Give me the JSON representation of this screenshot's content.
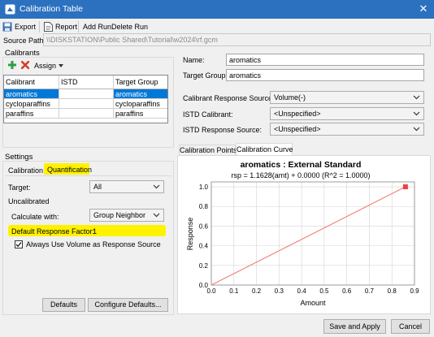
{
  "window": {
    "title": "Calibration Table",
    "close_glyph": "✕"
  },
  "toolbar": {
    "export_label": "Export",
    "report_label": "Report",
    "add_run_label": "Add Run",
    "delete_run_label": "Delete Run"
  },
  "source_path": {
    "label": "Source Path:",
    "value": "\\\\DISKSTATION\\Public Shared\\Tutorial\\w2024\\rf.gcm"
  },
  "calibrants": {
    "title": "Calibrants",
    "assign_label": "Assign",
    "columns": [
      "Calibrant",
      "ISTD",
      "Target Group"
    ],
    "rows": [
      {
        "calibrant": "aromatics",
        "istd": "",
        "group": "aromatics",
        "selected": true
      },
      {
        "calibrant": "cycloparaffins",
        "istd": "",
        "group": "cycloparaffins",
        "selected": false
      },
      {
        "calibrant": "paraffins",
        "istd": "",
        "group": "paraffins",
        "selected": false
      }
    ]
  },
  "settings": {
    "title": "Settings",
    "tabs": [
      "Calibration",
      "Quantification"
    ],
    "active_tab": "Quantification",
    "target_label": "Target:",
    "target_value": "All",
    "uncalibrated_label": "Uncalibrated",
    "calc_with_label": "Calculate with:",
    "calc_with_value": "Group Neighbor",
    "default_rf_label": "Default Response Factor:",
    "default_rf_value": "1",
    "always_volume_label": "Always Use Volume as Response Source",
    "always_volume_checked": true,
    "defaults_button": "Defaults",
    "configure_defaults_button": "Configure Defaults...",
    "highlight_color": "#fff200"
  },
  "details": {
    "name_label": "Name:",
    "name_value": "aromatics",
    "target_group_label": "Target Group:",
    "target_group_value": "aromatics",
    "response_source_label": "Calibrant Response Source:",
    "response_source_value": "Volume(-)",
    "istd_calibrant_label": "ISTD Calibrant:",
    "istd_calibrant_value": "<Unspecified>",
    "istd_response_label": "ISTD Response Source:",
    "istd_response_value": "<Unspecified>"
  },
  "chart_tabs": [
    "Calibration Points",
    "Calibration Curve"
  ],
  "chart_tab_active": "Calibration Curve",
  "chart_data": {
    "type": "line",
    "title": "aromatics : External Standard",
    "subtitle": "rsp = 1.1628(amt) + 0.0000 (R^2 = 1.0000)",
    "xlabel": "Amount",
    "ylabel": "Response",
    "xlim": [
      0,
      0.9
    ],
    "ylim": [
      0,
      1.05
    ],
    "x_ticks": [
      "0.0",
      "0.1",
      "0.2",
      "0.3",
      "0.4",
      "0.5",
      "0.6",
      "0.7",
      "0.8",
      "0.9"
    ],
    "y_ticks": [
      "0.0",
      "0.2",
      "0.4",
      "0.6",
      "0.8",
      "1.0"
    ],
    "grid": true,
    "line": {
      "slope": 1.1628,
      "intercept": 0.0,
      "x_start": 0,
      "x_end": 0.86
    },
    "points": [
      {
        "x": 0.86,
        "y": 1.0
      }
    ],
    "colors": {
      "line": "#f08070",
      "point": "#f04040",
      "grid": "#d4d4d4"
    }
  },
  "footer": {
    "save_apply": "Save and Apply",
    "cancel": "Cancel"
  },
  "colors": {
    "titlebar": "#2b71bf",
    "selection": "#0078d7",
    "add": "#2ea043",
    "delete": "#d83b2f"
  }
}
